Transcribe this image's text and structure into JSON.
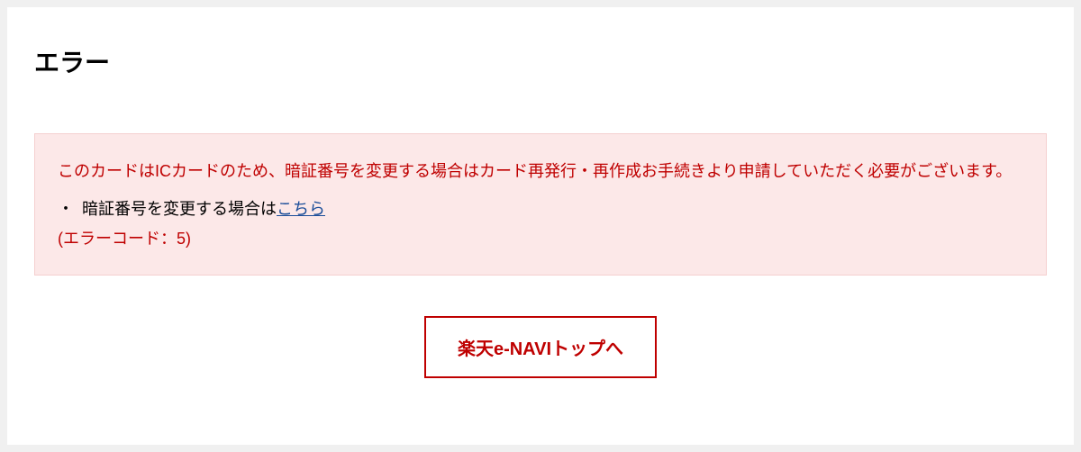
{
  "page": {
    "title": "エラー"
  },
  "error": {
    "message": "このカードはICカードのため、暗証番号を変更する場合はカード再発行・再作成お手続きより申請していただく必要がございます。",
    "instruction_prefix": "暗証番号を変更する場合は",
    "instruction_link": "こちら",
    "code_label": "(エラーコード：5)"
  },
  "button": {
    "label": "楽天e-NAVIトップへ"
  }
}
